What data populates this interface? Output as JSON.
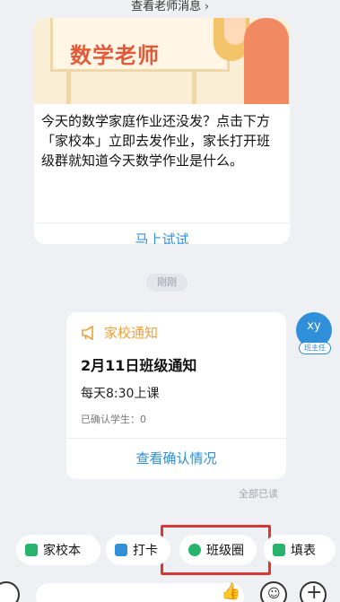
{
  "top_link": {
    "label": "查看老师消息",
    "chevron": "›"
  },
  "promo_card": {
    "banner_title": "数学老师",
    "text": "今天的数学家庭作业还没发？点击下方「家校本」立即去发作业，家长打开班级群就知道今天数学作业是什么。",
    "action": "马上试试"
  },
  "time_label": "刚刚",
  "notice_card": {
    "header_icon": "megaphone-icon",
    "header_label": "家校通知",
    "title": "2月11日班级通知",
    "body": "每天8:30上课",
    "confirm_count": "已确认学生：0",
    "action": "查看确认情况"
  },
  "sender": {
    "initials": "xy",
    "role": "班主任"
  },
  "read_state": "全部已读",
  "toolbar": [
    {
      "label": "家校本",
      "icon": "homework-book-icon",
      "color": "#27b36c"
    },
    {
      "label": "打卡",
      "icon": "checkin-icon",
      "color": "#2f8fd8"
    },
    {
      "label": "班级圈",
      "icon": "class-circle-icon",
      "color": "#27b36c"
    },
    {
      "label": "填表",
      "icon": "form-icon",
      "color": "#27b36c"
    }
  ],
  "composer": {
    "mic_icon": "microphone-icon",
    "like_icon": "thumbs-up-icon",
    "emoji_icon": "emoji-icon",
    "plus_icon": "plus-icon"
  },
  "colors": {
    "accent": "#2f8fd8",
    "notice_orange": "#f0a038",
    "highlight": "#d43a33",
    "background": "#eef0f3"
  }
}
